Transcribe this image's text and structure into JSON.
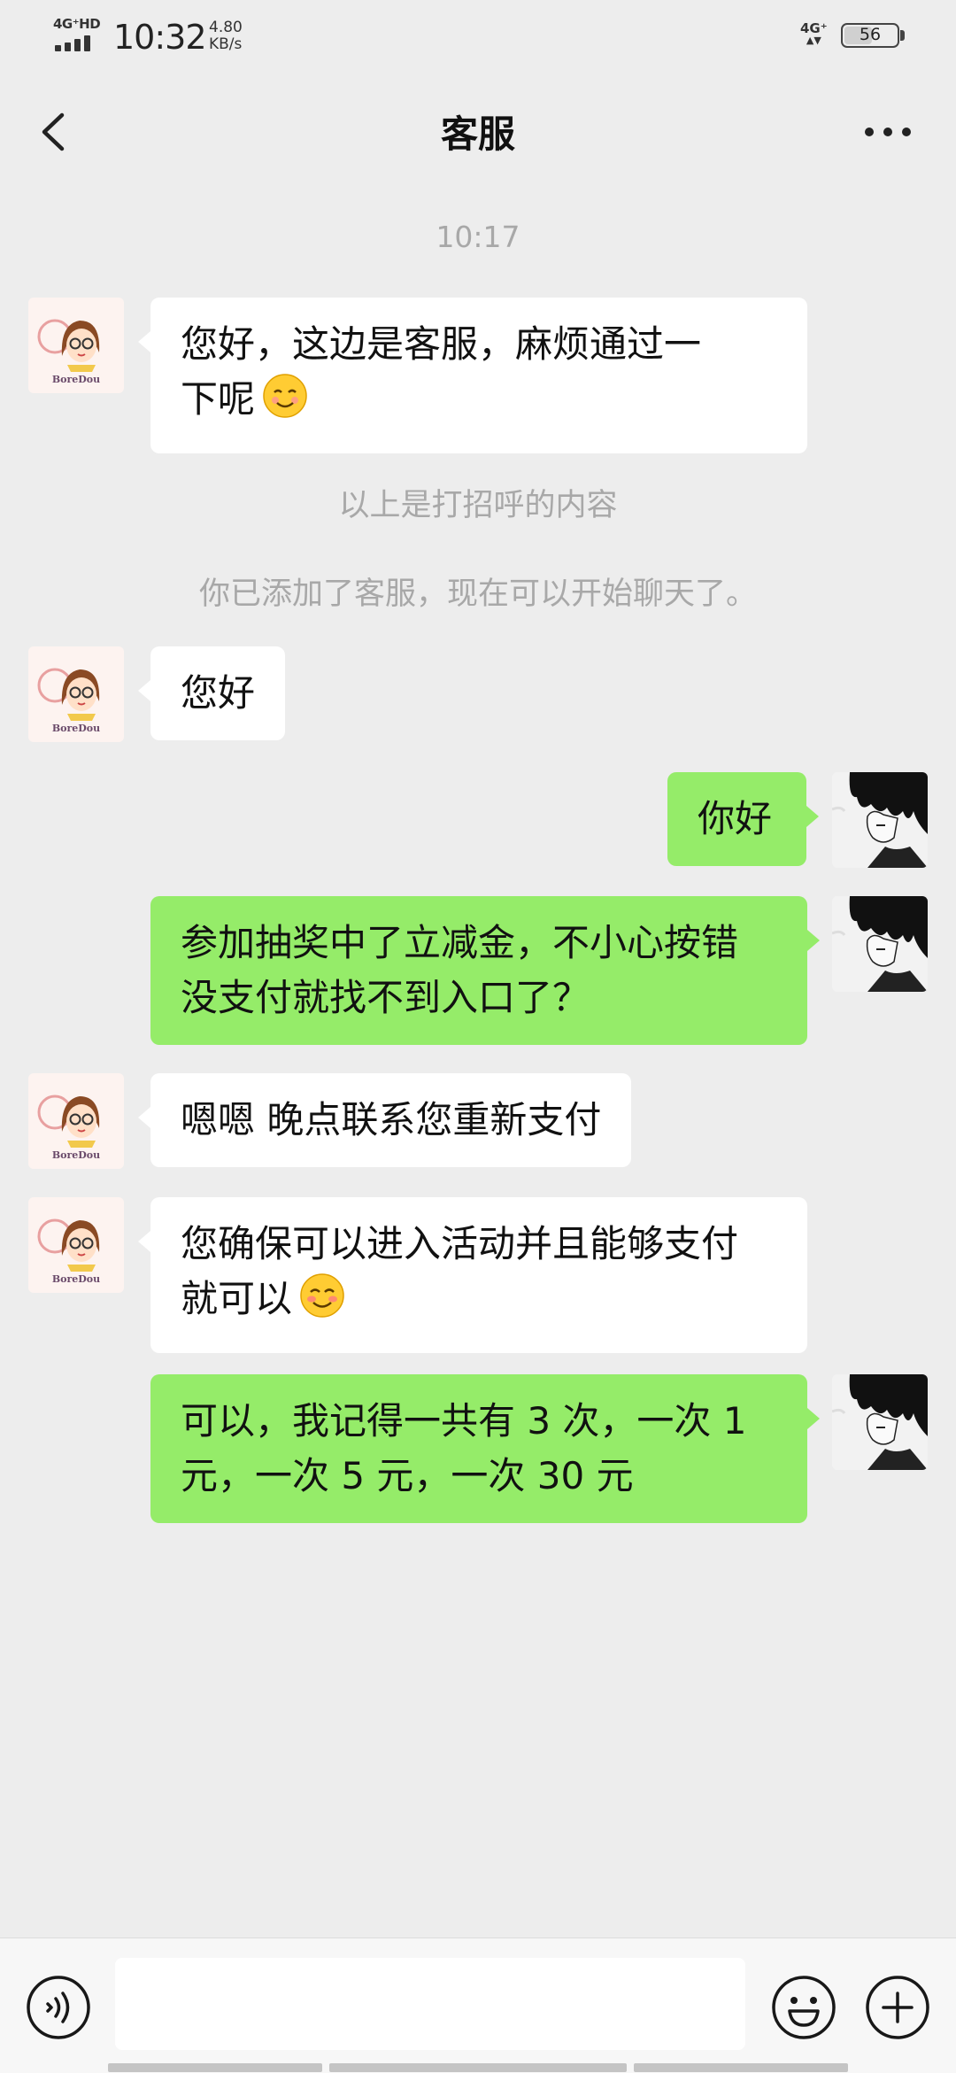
{
  "status_bar": {
    "signal_type": "4G⁺HD",
    "time": "10:32",
    "speed_value": "4.80",
    "speed_unit": "KB/s",
    "network": "4G⁺",
    "battery": "56",
    "battery_level": 0.56
  },
  "header": {
    "title": "客服",
    "back_icon": "chevron-left-icon",
    "more_icon": "more-horizontal-icon"
  },
  "chat": {
    "timestamp": "10:17",
    "system_messages": [
      "以上是打招呼的内容",
      "你已添加了客服，现在可以开始聊天了。"
    ],
    "messages": [
      {
        "sender": "客服",
        "direction": "in",
        "lines": [
          "您好，这边是客服，麻烦通过一",
          "下呢"
        ],
        "emoji": "smiling-face-emoji"
      },
      {
        "sender": "客服",
        "direction": "in",
        "lines": [
          "您好"
        ]
      },
      {
        "sender": "me",
        "direction": "out",
        "lines": [
          "你好"
        ]
      },
      {
        "sender": "me",
        "direction": "out",
        "lines": [
          "参加抽奖中了立减金，不小心按错",
          "没支付就找不到入口了？"
        ]
      },
      {
        "sender": "客服",
        "direction": "in",
        "lines": [
          "嗯嗯 晚点联系您重新支付"
        ]
      },
      {
        "sender": "客服",
        "direction": "in",
        "lines": [
          "您确保可以进入活动并且能够支付",
          "就可以"
        ],
        "emoji": "blush-emoji"
      },
      {
        "sender": "me",
        "direction": "out",
        "lines": [
          "可以，我记得一共有 3 次，一次 1",
          "元，一次 5 元，一次 30 元"
        ]
      }
    ],
    "avatar_text": "BoreDou"
  },
  "input_bar": {
    "placeholder": "",
    "icons": [
      "voice-icon",
      "emoji-icon",
      "plus-icon"
    ]
  },
  "colors": {
    "background": "#ededed",
    "incoming_bubble": "#ffffff",
    "outgoing_bubble": "#95ec69",
    "system_text": "#a8a8a8"
  }
}
